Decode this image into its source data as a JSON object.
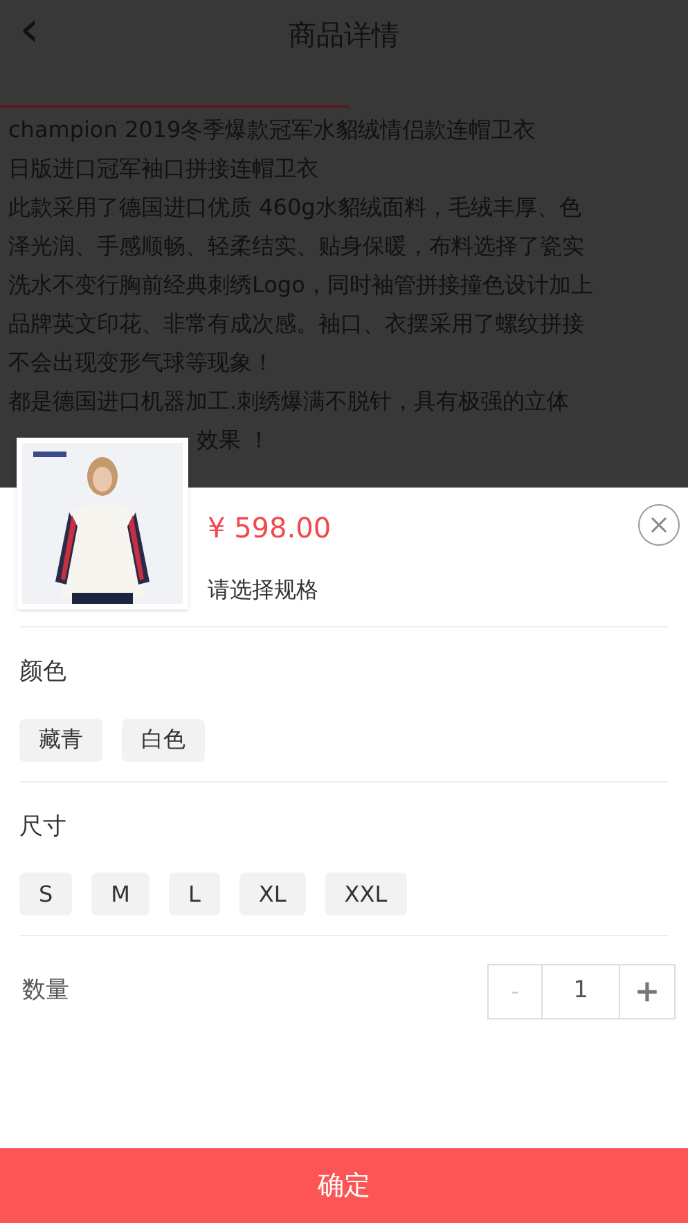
{
  "header": {
    "title": "商品详情",
    "back": "‹"
  },
  "description": [
    "champion 2019冬季爆款冠军水貂绒情侣款连帽卫衣",
    "日版进口冠军袖口拼接连帽卫衣",
    "此款采用了德国进口优质 460g水貂绒面料，毛绒丰厚、色",
    "泽光润、手感顺畅、轻柔结实、贴身保暖，布料选择了瓷实",
    "洗水不变行胸前经典刺绣Logo，同时袖管拼接撞色设计加上",
    "品牌英文印花、非常有成次感。袖口、衣摆采用了螺纹拼接",
    "不会出现变形气球等现象！",
    "都是德国进口机器加工.刺绣爆满不脱针，具有极强的立体",
    "效果 ！"
  ],
  "sheet": {
    "price": "¥ 598.00",
    "hint": "请选择规格",
    "groups": [
      {
        "label": "颜色",
        "options": [
          {
            "text": "藏青",
            "selected": false
          },
          {
            "text": "白色",
            "selected": false
          }
        ]
      },
      {
        "label": "尺寸",
        "options": [
          {
            "text": "S",
            "selected": false
          },
          {
            "text": "M",
            "selected": false
          },
          {
            "text": "L",
            "selected": false
          },
          {
            "text": "XL",
            "selected": false
          },
          {
            "text": "XXL",
            "selected": false
          }
        ]
      }
    ],
    "quantity": {
      "label": "数量",
      "minus": "-",
      "value": "1",
      "plus": "+",
      "minus_disabled": true
    },
    "confirm": "确定"
  }
}
